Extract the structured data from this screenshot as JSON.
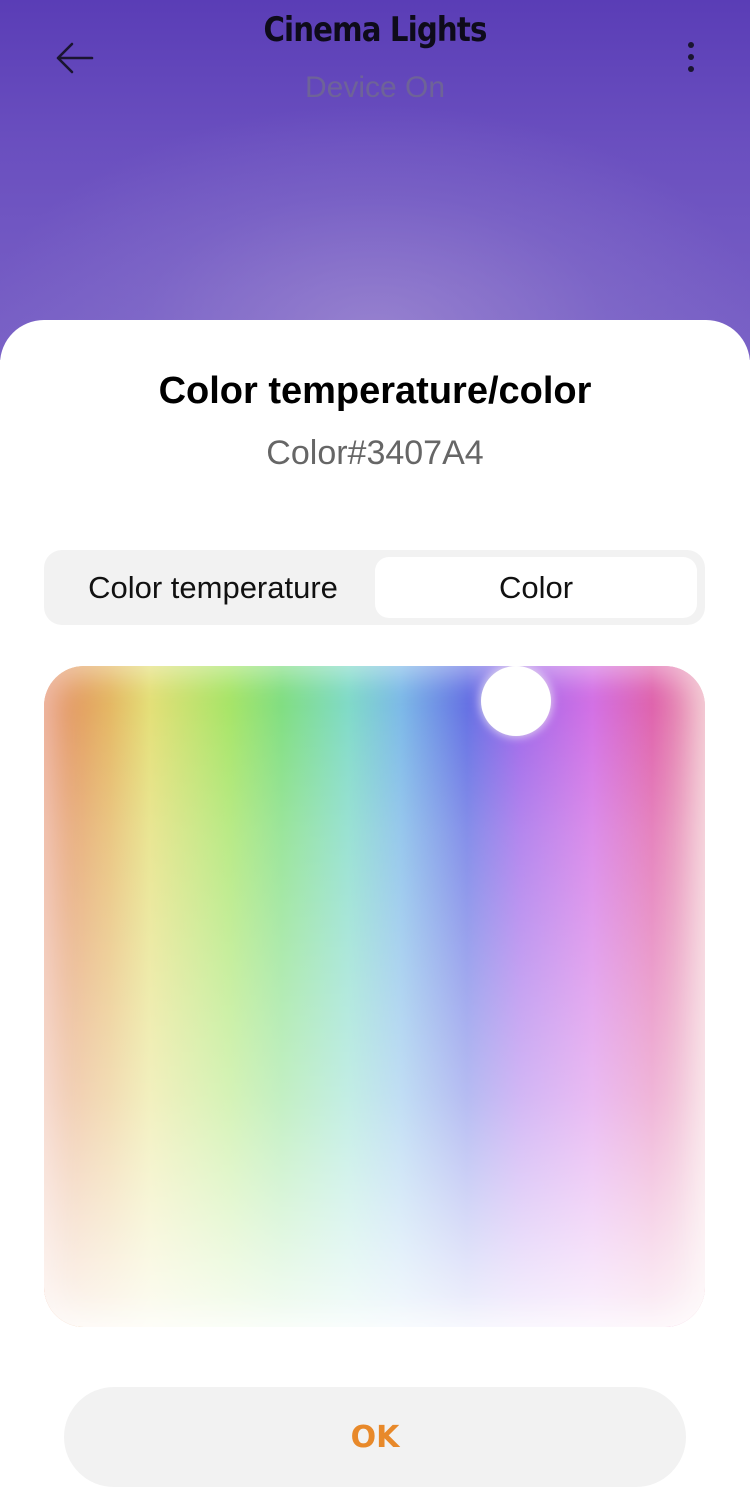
{
  "header": {
    "title": "Cinema Lights",
    "subtitle": "Device On",
    "back_icon": "arrow-left-icon",
    "menu_icon": "more-vertical-icon"
  },
  "sheet": {
    "title": "Color temperature/color",
    "current_value": "Color#3407A4",
    "tabs": [
      {
        "label": "Color temperature",
        "selected": false
      },
      {
        "label": "Color",
        "selected": true
      }
    ],
    "ok_label": "OK"
  },
  "colors": {
    "accent": "#E8892A",
    "header_bg": "#5A3DB6",
    "selected_color": "#3407A4"
  }
}
